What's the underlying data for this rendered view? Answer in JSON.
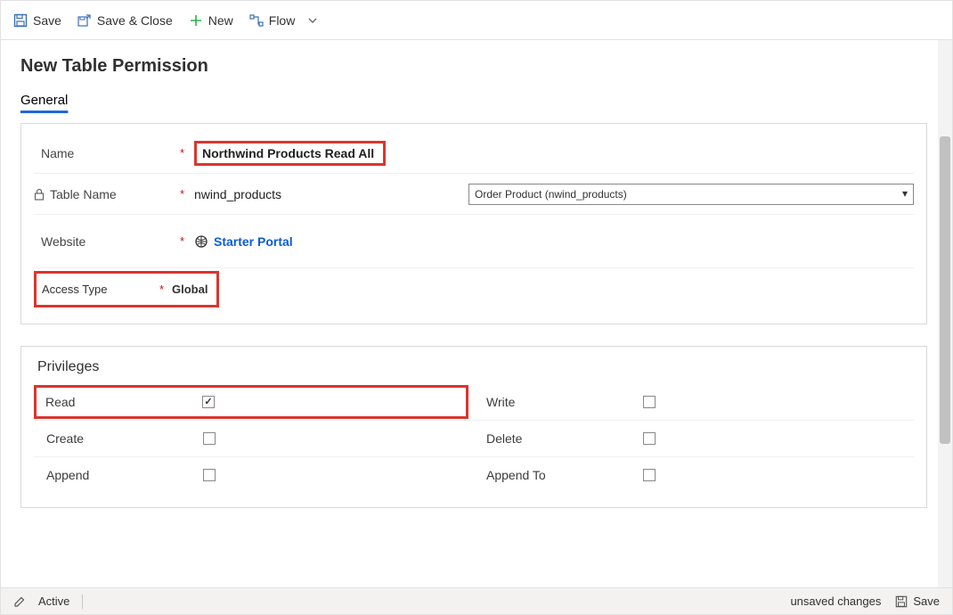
{
  "commands": {
    "save": "Save",
    "save_close": "Save & Close",
    "new": "New",
    "flow": "Flow"
  },
  "page": {
    "title": "New Table Permission"
  },
  "tabs": {
    "general": "General"
  },
  "fields": {
    "name": {
      "label": "Name",
      "value": "Northwind Products Read All",
      "required": "*"
    },
    "table_name": {
      "label": "Table Name",
      "value": "nwind_products",
      "required": "*",
      "select_display": "Order Product (nwind_products)"
    },
    "website": {
      "label": "Website",
      "value": "Starter Portal",
      "required": "*"
    },
    "access_type": {
      "label": "Access Type",
      "value": "Global",
      "required": "*"
    }
  },
  "privileges": {
    "title": "Privileges",
    "read": {
      "label": "Read",
      "checked": true
    },
    "write": {
      "label": "Write",
      "checked": false
    },
    "create": {
      "label": "Create",
      "checked": false
    },
    "delete": {
      "label": "Delete",
      "checked": false
    },
    "append": {
      "label": "Append",
      "checked": false
    },
    "append_to": {
      "label": "Append To",
      "checked": false
    }
  },
  "footer": {
    "status": "Active",
    "unsaved": "unsaved changes",
    "save": "Save"
  }
}
